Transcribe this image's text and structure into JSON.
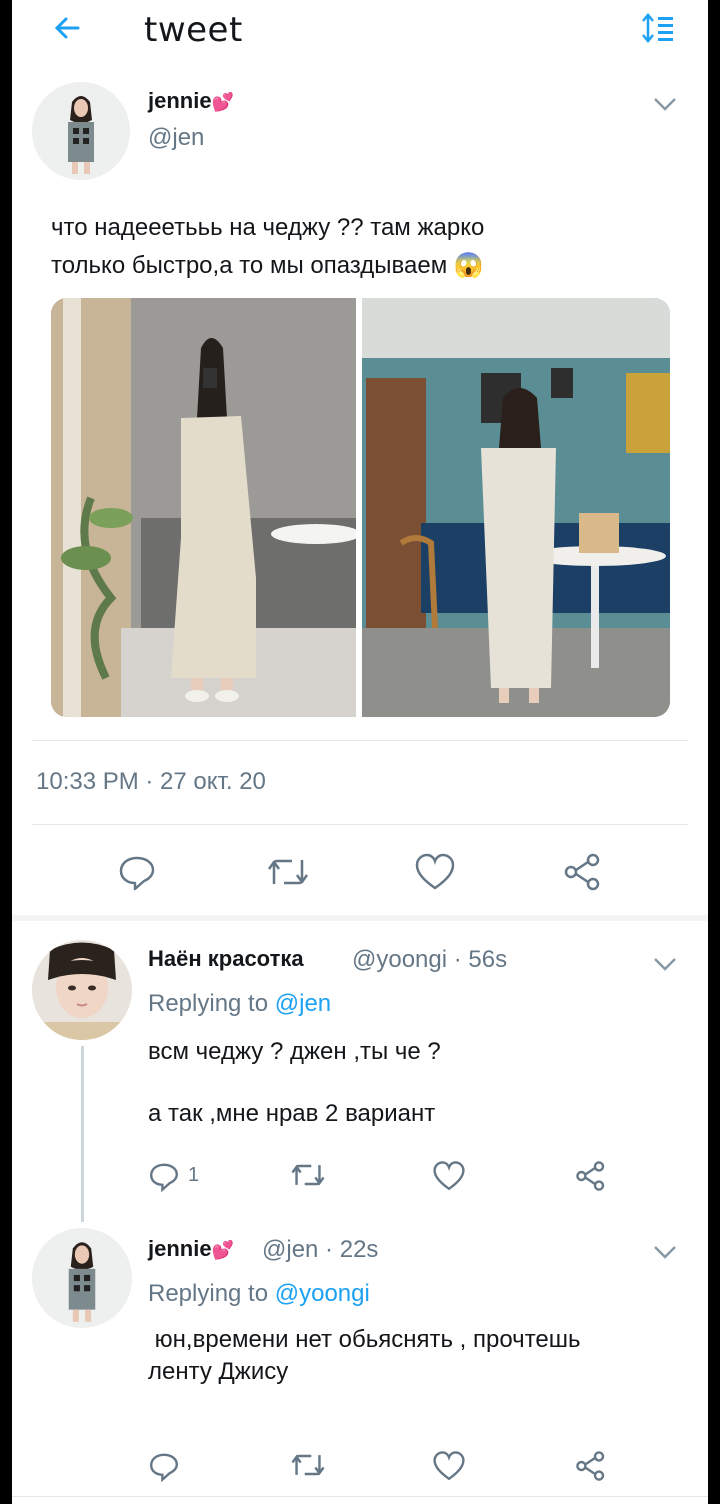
{
  "header": {
    "title": "tweet",
    "back_icon": "back-arrow-icon",
    "right_icon": "sort-list-icon"
  },
  "main_tweet": {
    "name": "jennie",
    "name_emoji": "💕",
    "handle": "@jen",
    "text_line1": "что надееетььь на чеджу ?? там жарко",
    "text_line2": "только быстро,а то мы опаздываем 😱",
    "timestamp": "10:33 PM · 27 окт. 20",
    "actions": [
      "reply-icon",
      "retweet-icon",
      "like-icon",
      "share-icon"
    ]
  },
  "replies": [
    {
      "name": "Наён красотка",
      "handle_time": "@yoongi · 56s",
      "replying_prefix": "Replying to ",
      "replying_to": "@jen",
      "text_line1": "всм чеджу ? джен ,ты че ?",
      "text_line2": "а так ,мне нрав 2 вариант",
      "reply_count": "1"
    },
    {
      "name": "jennie",
      "name_emoji": "💕",
      "handle_time": "@jen · 22s",
      "replying_prefix": "Replying to ",
      "replying_to": "@yoongi",
      "text_line1": " юн,времени нет обьяснять , прочтешь",
      "text_line2": "ленту Джису"
    }
  ],
  "colors": {
    "accent": "#1da1f2",
    "secondary_text": "#657786",
    "divider": "#e1e8ed"
  }
}
